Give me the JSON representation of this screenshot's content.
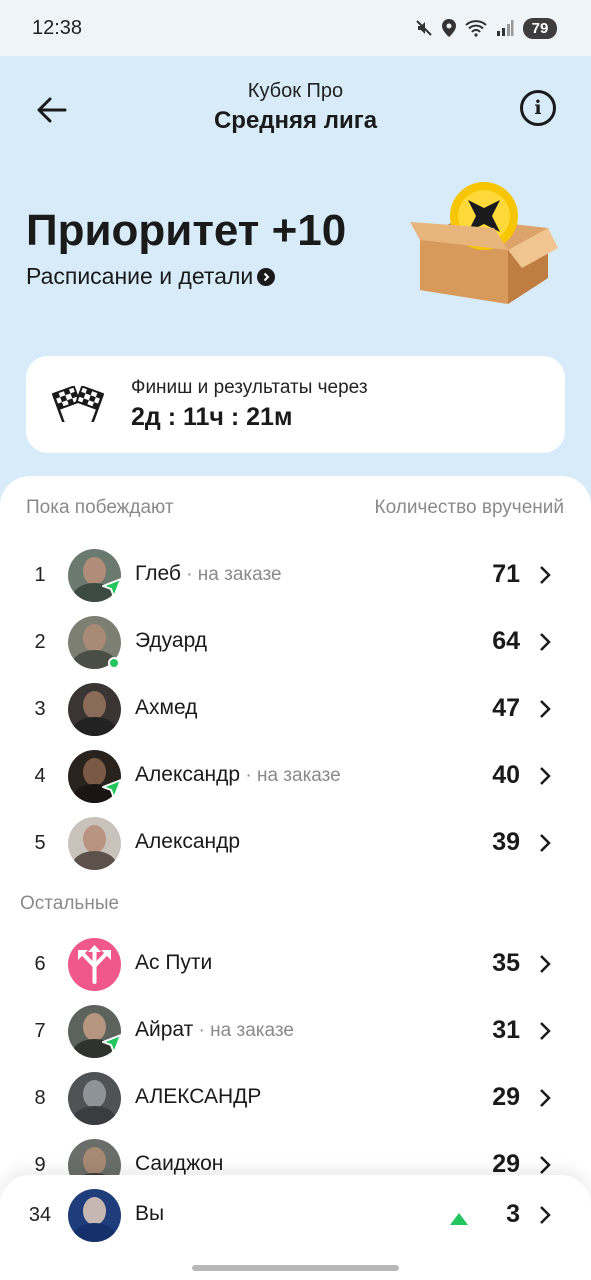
{
  "status_bar": {
    "time": "12:38",
    "battery": "79"
  },
  "header": {
    "title": "Кубок Про",
    "subtitle": "Средняя лига"
  },
  "hero": {
    "title": "Приоритет +10",
    "link_label": "Расписание и детали"
  },
  "timer": {
    "label": "Финиш и результаты через",
    "value": "2д : 11ч : 21м"
  },
  "leaderboard": {
    "col_left": "Пока побеждают",
    "col_right": "Количество вручений",
    "others_label": "Остальные",
    "leaders": [
      {
        "rank": "1",
        "name": "Глеб",
        "status": " · на заказе",
        "count": "71"
      },
      {
        "rank": "2",
        "name": "Эдуард",
        "status": "",
        "count": "64"
      },
      {
        "rank": "3",
        "name": "Ахмед",
        "status": "",
        "count": "47"
      },
      {
        "rank": "4",
        "name": "Александр",
        "status": " · на заказе",
        "count": "40"
      },
      {
        "rank": "5",
        "name": "Александр",
        "status": "",
        "count": "39"
      }
    ],
    "others": [
      {
        "rank": "6",
        "name": "Ас Пути",
        "status": "",
        "count": "35"
      },
      {
        "rank": "7",
        "name": "Айрат",
        "status": " · на заказе",
        "count": "31"
      },
      {
        "rank": "8",
        "name": "АЛЕКСАНДР",
        "status": "",
        "count": "29"
      },
      {
        "rank": "9",
        "name": "Саиджон",
        "status": "",
        "count": "29"
      }
    ],
    "me": {
      "rank": "34",
      "name": "Вы",
      "count": "3"
    }
  },
  "colors": {
    "background": "#d7ebf8",
    "accent_green": "#22c55e",
    "pink_avatar": "#f0578a"
  }
}
